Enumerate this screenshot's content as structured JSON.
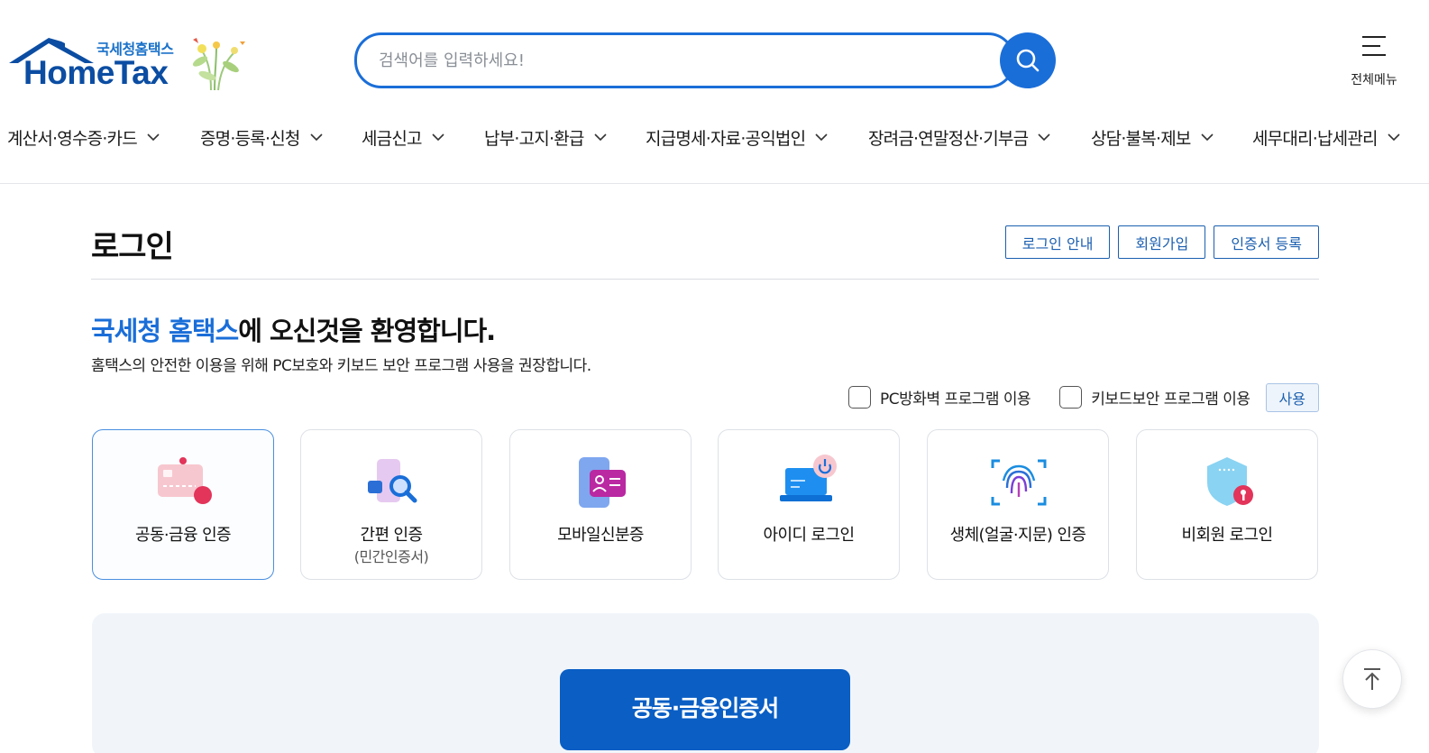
{
  "header": {
    "logo": {
      "sub": "국세청홈택스",
      "main": "HomeTax"
    },
    "search": {
      "placeholder": "검색어를 입력하세요!"
    },
    "all_menu_label": "전체메뉴",
    "nav": [
      "계산서·영수증·카드",
      "증명·등록·신청",
      "세금신고",
      "납부·고지·환급",
      "지급명세·자료·공익법인",
      "장려금·연말정산·기부금",
      "상담·불복·제보",
      "세무대리·납세관리"
    ]
  },
  "page": {
    "title": "로그인",
    "buttons": [
      "로그인 안내",
      "회원가입",
      "인증서 등록"
    ],
    "welcome_highlight": "국세청 홈택스",
    "welcome_rest": "에 오신것을 환영합니다.",
    "notice": "홈택스의 안전한 이용을 위해 PC보호와 키보드 보안 프로그램 사용을 권장합니다.",
    "options": {
      "firewall": "PC방화벽 프로그램 이용",
      "keyboard": "키보드보안 프로그램 이용",
      "use_button": "사용"
    }
  },
  "login_methods": [
    {
      "label": "공동·금융 인증",
      "sublabel": "",
      "icon": "certificate-card-icon",
      "selected": true
    },
    {
      "label": "간편 인증",
      "sublabel": "(민간인증서)",
      "icon": "phone-search-icon",
      "selected": false
    },
    {
      "label": "모바일신분증",
      "sublabel": "",
      "icon": "mobile-id-icon",
      "selected": false
    },
    {
      "label": "아이디 로그인",
      "sublabel": "",
      "icon": "laptop-power-icon",
      "selected": false
    },
    {
      "label": "생체(얼굴·지문) 인증",
      "sublabel": "",
      "icon": "fingerprint-icon",
      "selected": false
    },
    {
      "label": "비회원 로그인",
      "sublabel": "",
      "icon": "shield-lock-icon",
      "selected": false
    }
  ],
  "panel": {
    "cert_button": "공동·금융인증서"
  },
  "colors": {
    "primary": "#1a6ed8",
    "brand_dark": "#0b4da2",
    "button_blue": "#0a5ec4"
  }
}
